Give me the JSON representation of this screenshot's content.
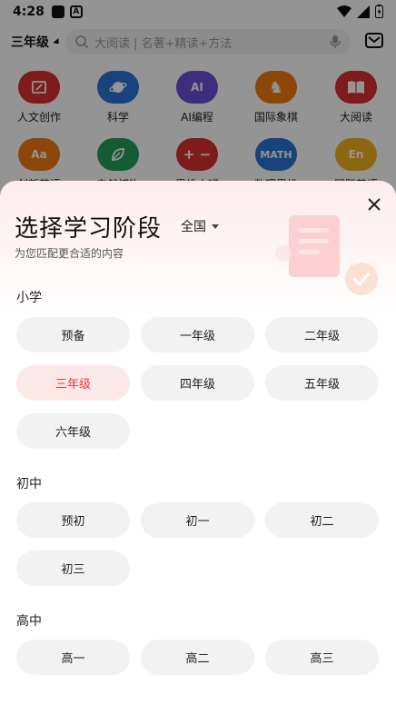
{
  "status": {
    "time": "4:28",
    "a_icon_text": "A"
  },
  "topbar": {
    "grade": "三年级",
    "search_placeholder": "大阅读 | 名著+精读+方法"
  },
  "categories": [
    {
      "label": "人文创作",
      "color": "#d8312e"
    },
    {
      "label": "科学",
      "color": "#2c74d6"
    },
    {
      "label": "AI编程",
      "color": "#6b4fd6",
      "icon_text": "AI"
    },
    {
      "label": "国际象棋",
      "color": "#f07a12"
    },
    {
      "label": "大阅读",
      "color": "#d8312e"
    },
    {
      "label": "创新英语",
      "color": "#f07a12",
      "icon_text": "Aa"
    },
    {
      "label": "自然博物",
      "color": "#23a05a"
    },
    {
      "label": "思维小班",
      "color": "#d8312e"
    },
    {
      "label": "数理思维",
      "color": "#2c74d6",
      "icon_text": "MATH"
    },
    {
      "label": "国际英语",
      "color": "#f2b21a",
      "icon_text": "En"
    }
  ],
  "sheet": {
    "title": "选择学习阶段",
    "region": "全国",
    "subtitle": "为您匹配更合适的内容",
    "accent_color": "#e53935",
    "sections": [
      {
        "title": "小学",
        "items": [
          "预备",
          "一年级",
          "二年级",
          "三年级",
          "四年级",
          "五年级",
          "六年级"
        ],
        "selected": "三年级"
      },
      {
        "title": "初中",
        "items": [
          "预初",
          "初一",
          "初二",
          "初三"
        ]
      },
      {
        "title": "高中",
        "items": [
          "高一",
          "高二",
          "高三"
        ]
      }
    ]
  }
}
